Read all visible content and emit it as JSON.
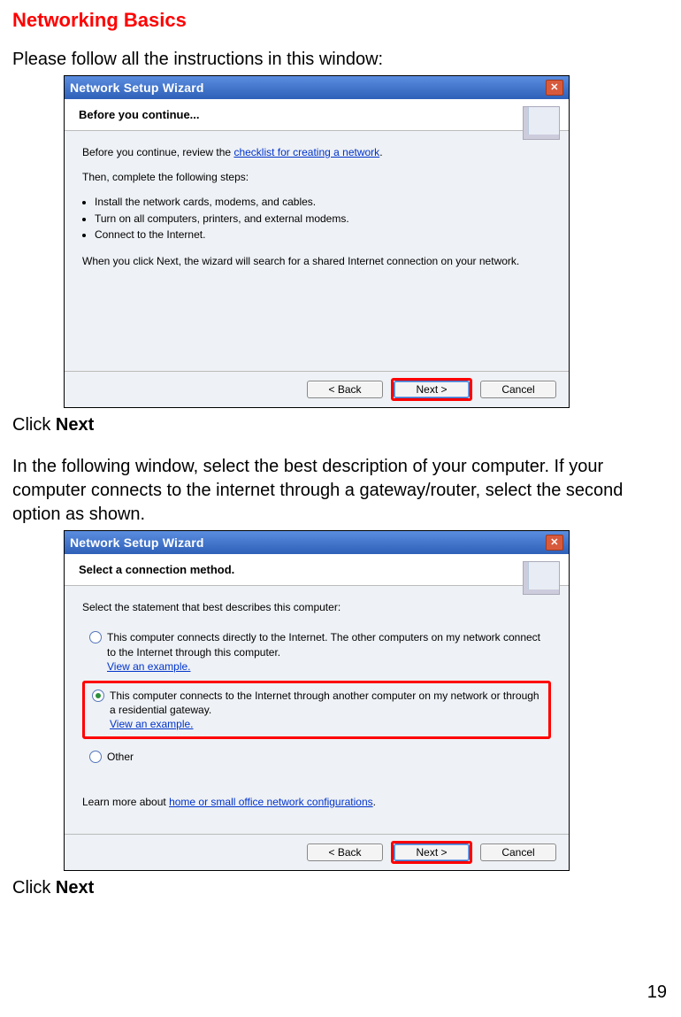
{
  "doc": {
    "heading": "Networking Basics",
    "intro": "Please follow all the instructions in this window:",
    "click_next_1": "Click ",
    "click_next_1_bold": "Next",
    "middle_para": "In the following window, select the best description of your computer.  If your computer connects to the internet through a gateway/router, select the second option as shown.",
    "click_next_2": "Click ",
    "click_next_2_bold": "Next",
    "page_number": "19"
  },
  "wiz1": {
    "title": "Network Setup Wizard",
    "header_line1": "Before you continue...",
    "body_intro_pre": "Before you continue, review the ",
    "body_intro_link": "checklist for creating a network",
    "body_intro_post": ".",
    "then_line": "Then, complete the following steps:",
    "bullets": [
      "Install the network cards, modems, and cables.",
      "Turn on all computers, printers, and external modems.",
      "Connect to the Internet."
    ],
    "closing": "When you click Next, the wizard will search for a shared Internet connection on your network.",
    "btn_back": "< Back",
    "btn_next": "Next >",
    "btn_cancel": "Cancel"
  },
  "wiz2": {
    "title": "Network Setup Wizard",
    "header_line1": "Select a connection method.",
    "prompt": "Select the statement that best describes this computer:",
    "opt1_text": "This computer connects directly to the Internet. The other computers on my network connect to the Internet through this computer.",
    "opt1_link": "View an example.",
    "opt2_text": "This computer connects to the Internet through another computer on my network or through a residential gateway.",
    "opt2_link": "View an example.",
    "opt3_text": "Other",
    "learn_pre": "Learn more about ",
    "learn_link": "home or small office network configurations",
    "learn_post": ".",
    "btn_back": "< Back",
    "btn_next": "Next >",
    "btn_cancel": "Cancel"
  }
}
